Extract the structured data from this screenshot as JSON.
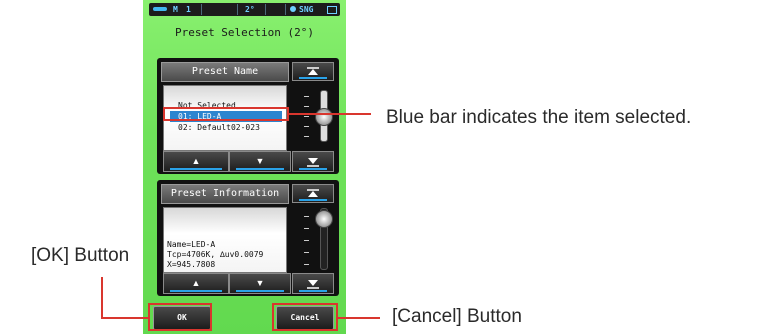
{
  "status_bar": {
    "mode": "M",
    "number": "1",
    "angle": "2°",
    "sync": "SNG"
  },
  "screen_title": "Preset Selection (2°)",
  "preset_name_panel": {
    "header": "Preset Name",
    "items": [
      "Not Selected",
      "01: LED-A",
      "02: Default02-023"
    ],
    "selected_index": 1
  },
  "preset_info_panel": {
    "header": "Preset Information",
    "lines": [
      "Name=LED-A",
      "Tcp=4706K, ∆uv0.0079",
      "X=945.7808"
    ]
  },
  "buttons": {
    "ok": "OK",
    "cancel": "Cancel"
  },
  "icons": {
    "up": "▲",
    "down": "▼",
    "top": "top-arrow-icon",
    "bottom": "bottom-arrow-icon"
  },
  "annotations": {
    "blue_bar": "Blue bar indicates the item selected.",
    "ok_button": "[OK] Button",
    "cancel_button": "[Cancel] Button"
  },
  "colors": {
    "screen": "#6fe25a",
    "highlight": "#2c85cf",
    "callout": "#d9362e"
  }
}
